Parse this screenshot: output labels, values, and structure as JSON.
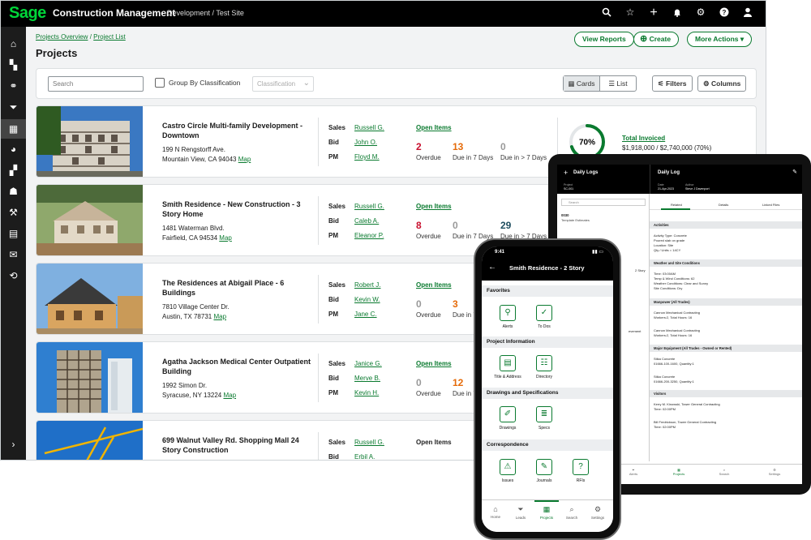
{
  "brand": {
    "logo": "Sage",
    "app": "Construction Management",
    "context": "Development / Test Site",
    "accent": "#0a7a2f"
  },
  "top_icons": [
    "search-icon",
    "star-icon",
    "plus-icon",
    "bell-icon",
    "gear-icon",
    "help-icon",
    "user-icon"
  ],
  "breadcrumbs": {
    "first": "Projects Overview",
    "sep": "/",
    "second": "Project List"
  },
  "page_title": "Projects",
  "header_buttons": {
    "view_reports": "View Reports",
    "create": "Create",
    "more_actions": "More Actions"
  },
  "filters": {
    "search_placeholder": "Search",
    "group_label": "Group By Classification",
    "classification_placeholder": "Classification",
    "cards": "Cards",
    "list": "List",
    "filters": "Filters",
    "columns": "Columns"
  },
  "projects": [
    {
      "name": "Castro Circle Multi-family Development - Downtown",
      "addr1": "199 N Rengstorff Ave.",
      "addr2": "Mountain View, CA 94043",
      "map": "Map",
      "sales": "Russell G.",
      "bid": "John O.",
      "pm": "Floyd M.",
      "open_items": "Open Items",
      "overdue": "2",
      "due7": "13",
      "due_gt7": "0",
      "percent": "70%",
      "total_invoiced": "Total Invoiced",
      "invoiced_value": "$1,918,000 / $2,740,000 (70%)",
      "progress": 0.7
    },
    {
      "name": "Smith Residence - New Construction - 3 Story Home",
      "addr1": "1481 Waterman Blvd.",
      "addr2": "Fairfield, CA 94534",
      "map": "Map",
      "sales": "Russell G.",
      "bid": "Caleb A.",
      "pm": "Eleanor P.",
      "open_items": "Open Items",
      "overdue": "8",
      "due7": "0",
      "due_gt7": "29"
    },
    {
      "name": "The Residences at Abigail Place - 6 Buildings",
      "addr1": "7810 Village Center Dr.",
      "addr2": "Austin, TX 78731",
      "map": "Map",
      "sales": "Robert J.",
      "bid": "Kevin W.",
      "pm": "Jane C.",
      "open_items": "Open Items",
      "overdue": "0",
      "due7": "3"
    },
    {
      "name": "Agatha Jackson Medical Center Outpatient Building",
      "addr1": "1992 Simon Dr.",
      "addr2": "Syracuse, NY 13224",
      "map": "Map",
      "sales": "Janice G.",
      "bid": "Merve B.",
      "pm": "Kevin H.",
      "open_items": "Open Items",
      "overdue": "0",
      "due7": "12"
    },
    {
      "name": "699 Walnut Valley Rd. Shopping Mall 24 Story Construction",
      "sales": "Russell G.",
      "bid": "Erbil A.",
      "open_items": "Open Items"
    }
  ],
  "labels": {
    "sales": "Sales",
    "bid": "Bid",
    "pm": "PM",
    "overdue": "Overdue",
    "due7": "Due in 7 Days",
    "due_gt7": "Due in > 7 Days"
  },
  "tablet": {
    "left_title": "Daily Logs",
    "right_title": "Daily Log",
    "project_label": "Project",
    "project_value": "SC-001",
    "date_label": "Date",
    "date_value": "21-Apr-2023",
    "author_label": "Author",
    "author_value": "Steve J Davenport",
    "search": "Search",
    "item_code": "0030",
    "item_sub": "Template Estimates",
    "partial1": "2 Story",
    "partial2": "evement",
    "tabs": [
      "Related",
      "Details",
      "Linked Files"
    ],
    "sections": [
      {
        "title": "Activities",
        "lines": [
          "Activity Type: Concrete",
          "Poured slab on grade",
          "Location: Site",
          "Qty / Units = 14CY"
        ]
      },
      {
        "title": "Weather and Site Conditions",
        "lines": [
          "Time: 03:00AM",
          "Temp & Wind Conditions: 62",
          "Weather Conditions: Clear and Sunny",
          "Site Conditions: Dry"
        ]
      },
      {
        "title": "Manpower (All Trades)",
        "lines": [
          "Cannon Mechanical Contracting",
          "Workers:2, Total Hours: 16",
          "Cannon Mechanical Contracting",
          "Workers:2, Total Hours: 16"
        ]
      },
      {
        "title": "Major Equipment (All Trades - Owned or Rented)",
        "lines": [
          "Stika Concrete",
          "01666-100-1600, Quantity:1",
          "Stika Concrete",
          "01666-200-3250, Quantity:1"
        ]
      },
      {
        "title": "Visitors",
        "lines": [
          "Kerry M. Kinowski, Tower General Contracting",
          "Time: 02:00PM",
          "Bill Fredrickson, Tower General Contracting",
          "Time: 02:00PM"
        ]
      }
    ],
    "nav": [
      "Home",
      "Alerts",
      "Projects",
      "Search",
      "Settings"
    ]
  },
  "phone": {
    "time": "9:41",
    "title": "Smith Residence - 2 Story",
    "sections": [
      {
        "title": "Favorites",
        "items": [
          "Alerts",
          "To Dos"
        ]
      },
      {
        "title": "Project Information",
        "items": [
          "Title & Address",
          "Directory"
        ]
      },
      {
        "title": "Drawings and Specifications",
        "items": [
          "Drawings",
          "Specs"
        ]
      },
      {
        "title": "Correspondence",
        "items": [
          "Issues",
          "Journals",
          "RFIs"
        ]
      }
    ],
    "nav": [
      "Home",
      "Leads",
      "Projects",
      "Search",
      "Settings"
    ]
  }
}
